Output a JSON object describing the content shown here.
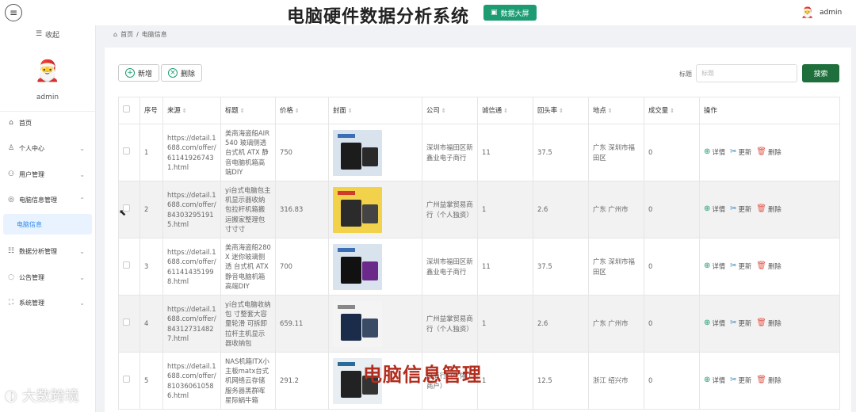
{
  "header": {
    "title": "电脑硬件数据分析系统",
    "big_screen_label": "数据大屏",
    "username": "admin"
  },
  "sidebar": {
    "collapse_label": "收起",
    "username": "admin",
    "items": [
      {
        "label": "首页"
      },
      {
        "label": "个人中心"
      },
      {
        "label": "用户管理"
      },
      {
        "label": "电脑信息管理"
      },
      {
        "label": "电脑信息"
      },
      {
        "label": "数据分析管理"
      },
      {
        "label": "公告管理"
      },
      {
        "label": "系统管理"
      }
    ]
  },
  "breadcrumb": {
    "home": "首页",
    "separator": "/",
    "current": "电脑信息"
  },
  "toolbar": {
    "add_label": "新增",
    "delete_label": "删除",
    "search_label": "标题",
    "search_placeholder": "标题",
    "search_button": "搜索"
  },
  "table": {
    "headers": {
      "index": "序号",
      "source": "来源",
      "title": "标题",
      "price": "价格",
      "cover": "封面",
      "company": "公司",
      "integrity": "诚信通",
      "repurchase": "回头率",
      "location": "地点",
      "deals": "成交量",
      "ops": "操作"
    },
    "rows": [
      {
        "index": "1",
        "source": "https://detail.1688.com/offer/611419267431.html",
        "title": "美商海盗船AIR 540 玻璃侧透 台式机 ATX 静音电脑机箱高端DIY",
        "price": "750",
        "company": "深圳市福田区新鑫业电子商行",
        "integrity": "11",
        "repurchase": "37.5",
        "location": "广东 深圳市福田区",
        "deals": "0"
      },
      {
        "index": "2",
        "source": "https://detail.1688.com/offer/843032951915.html",
        "title": "yi台式电脑包主机显示器收纳包拉杆机箱搬运搬家整理包寸寸寸",
        "price": "316.83",
        "company": "广州益掌贸易商行（个人独资）",
        "integrity": "1",
        "repurchase": "2.6",
        "location": "广东 广州市",
        "deals": "0"
      },
      {
        "index": "3",
        "source": "https://detail.1688.com/offer/611414351998.html",
        "title": "美商海盗船280X 迷你玻璃侧透 台式机 ATX静音电脑机箱高端DIY",
        "price": "700",
        "company": "深圳市福田区新鑫业电子商行",
        "integrity": "11",
        "repurchase": "37.5",
        "location": "广东 深圳市福田区",
        "deals": "0"
      },
      {
        "index": "4",
        "source": "https://detail.1688.com/offer/843127314827.html",
        "title": "yi台式电脑收纳包 寸整套大容量轮滑 可拆卸拉杆主机显示器收纳包",
        "price": "659.11",
        "company": "广州益掌贸易商行（个人独资）",
        "integrity": "1",
        "repurchase": "2.6",
        "location": "广东 广州市",
        "deals": "0"
      },
      {
        "index": "5",
        "source": "https://detail.1688.com/offer/810360610586.html",
        "title": "NAS机箱ITX小主板matx台式机网络云存储服务器黑群晖星际蜗牛箱",
        "price": "291.2",
        "company": "易商行（个体工商户）",
        "integrity": "1",
        "repurchase": "12.5",
        "location": "浙江 绍兴市",
        "deals": "0"
      }
    ],
    "action_labels": {
      "detail": "详情",
      "update": "更新",
      "delete": "删除"
    }
  },
  "overlay": {
    "caption": "电脑信息管理",
    "watermark": "大数跨境"
  },
  "colors": {
    "accent_green": "#1d9c73",
    "search_button": "#1e6f3b",
    "active_nav_bg": "#e9f3ff",
    "active_nav_text": "#2d8cf0",
    "overlay_red": "#b22d1e"
  }
}
